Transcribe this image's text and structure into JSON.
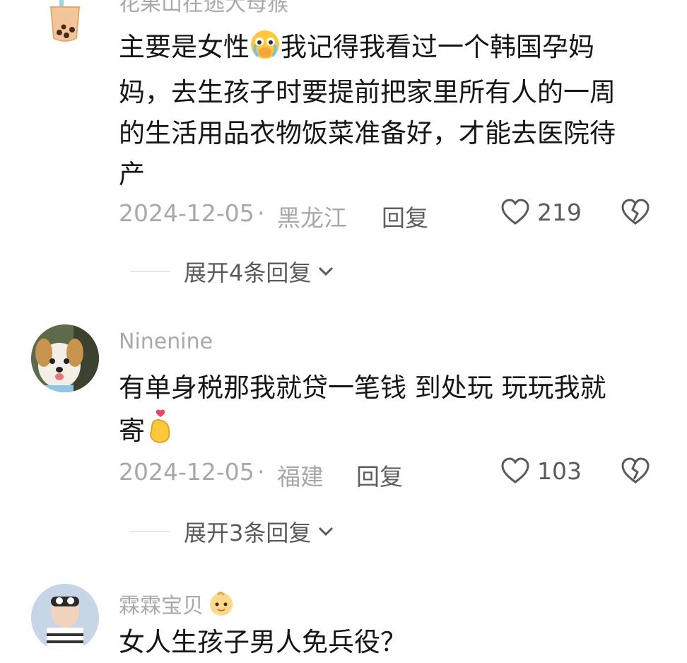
{
  "comments": [
    {
      "username": "花果山在逃大母猴",
      "avatar_icon": "bubble-tea-icon",
      "lines": [
        "主要是女性",
        "我记得我看过一个韩国孕妈",
        "妈，去生孩子时要提前把家里所有人的一周",
        "的生活用品衣物饭菜准备好，才能去医院待",
        "产"
      ],
      "emoji": "crying-face-emoji",
      "date": "2024-12-05",
      "location": "黑龙江",
      "reply_label": "回复",
      "likes": "219",
      "expand_label": "展开4条回复"
    },
    {
      "username": "Ninenine",
      "avatar_icon": "dog-avatar",
      "lines": [
        "有单身税那我就贷一笔钱 到处玩 玩玩我就",
        "寄"
      ],
      "emoji": "finger-heart-emoji",
      "date": "2024-12-05",
      "location": "福建",
      "reply_label": "回复",
      "likes": "103",
      "expand_label": "展开3条回复"
    },
    {
      "username": "霖霖宝贝",
      "avatar_icon": "baby-avatar",
      "name_emoji": "baby-emoji",
      "lines": [
        "女人生孩子男人免兵役？"
      ]
    }
  ],
  "colors": {
    "username": "#a9a9a9",
    "text": "#161616",
    "meta": "#a8a8a8",
    "action": "#5a5a5a"
  }
}
